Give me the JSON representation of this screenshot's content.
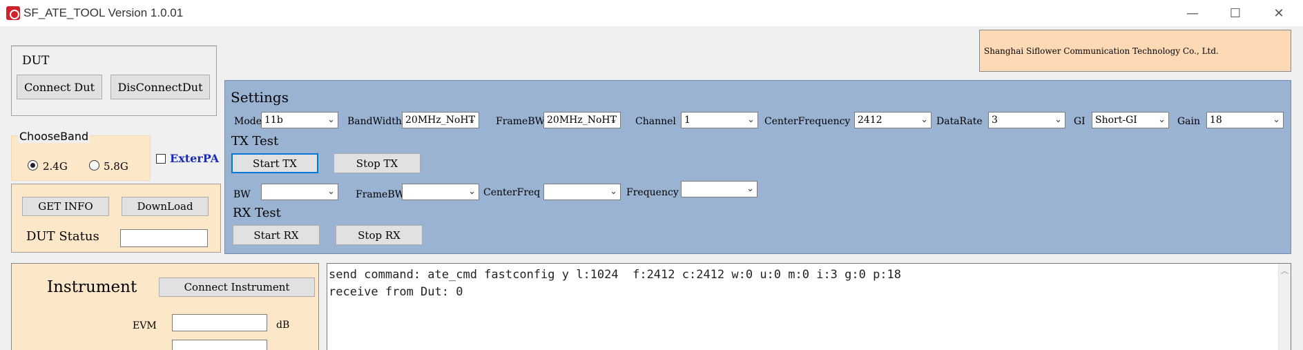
{
  "window": {
    "title": "SF_ATE_TOOL Version 1.0.01",
    "minimize_glyph": "—",
    "maximize_glyph": "☐",
    "close_glyph": "✕"
  },
  "dut": {
    "group_label": "DUT",
    "connect_label": "Connect Dut",
    "disconnect_label": "DisConnectDut"
  },
  "band": {
    "group_label": "ChooseBand",
    "option_24": "2.4G",
    "option_58": "5.8G",
    "selected": "2.4G",
    "exterpa_label": "ExterPA",
    "exterpa_checked": false
  },
  "info": {
    "get_info_label": "GET INFO",
    "download_label": "DownLoad",
    "status_label": "DUT Status",
    "status_value": ""
  },
  "company": {
    "name": "Shanghai Siflower Communication Technology Co., Ltd."
  },
  "settings": {
    "title": "Settings",
    "mode_label": "Mode",
    "mode_value": "11b",
    "bandwidth_label": "BandWidth",
    "bandwidth_value": "20MHz_NoHT",
    "framebw_label": "FrameBW",
    "framebw_value": "20MHz_NoHT",
    "channel_label": "Channel",
    "channel_value": "1",
    "centerfreq_label": "CenterFrequency",
    "centerfreq_value": "2412",
    "datarate_label": "DataRate",
    "datarate_value": "3",
    "gi_label": "GI",
    "gi_value": "Short-GI",
    "gain_label": "Gain",
    "gain_value": "18"
  },
  "tx": {
    "title": "TX Test",
    "start_label": "Start TX",
    "stop_label": "Stop TX"
  },
  "rx": {
    "bw_label": "BW",
    "framebw_label": "FrameBW",
    "centerfreq_label": "CenterFreq",
    "frequency_label": "Frequency",
    "title": "RX Test",
    "start_label": "Start RX",
    "stop_label": "Stop RX"
  },
  "instrument": {
    "title": "Instrument",
    "connect_label": "Connect Instrument",
    "evm_label": "EVM",
    "evm_value": "",
    "evm_unit": "dB"
  },
  "log": {
    "lines": [
      "send command: ate_cmd fastconfig y l:1024  f:2412 c:2412 w:0 u:0 m:0 i:3 g:0 p:18",
      "receive from Dut: 0"
    ]
  }
}
